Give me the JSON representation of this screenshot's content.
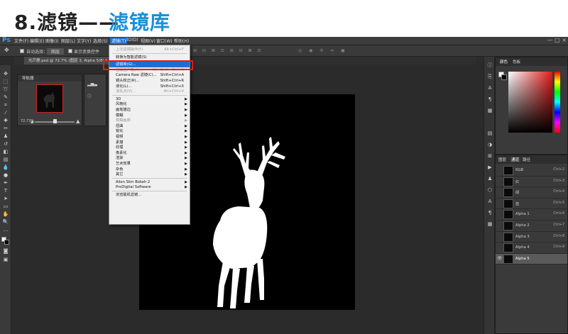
{
  "heading": {
    "prefix": "8.滤镜——",
    "highlight": "滤镜库",
    "accent_color": "#1a8fd6"
  },
  "app": {
    "logo": "Ps",
    "menu": [
      "文件(F)",
      "编辑(E)",
      "图像(I)",
      "图层(L)",
      "文字(Y)",
      "选择(S)",
      "滤镜(T)",
      "3D(D)",
      "视图(V)",
      "窗口(W)",
      "帮助(H)"
    ],
    "active_menu": "滤镜(T)",
    "window_controls": "— □ ×"
  },
  "options_bar": {
    "auto_select": "自动选择：",
    "layer_dropdown": "图层",
    "show_transform": "显示变换控件"
  },
  "document_tab": {
    "label": "光芒鹿.psd @ 72.7% (图层 3, Alpha 5/8) *",
    "close": "×"
  },
  "navigator": {
    "title": "导航器",
    "zoom": "72.73%"
  },
  "filter_menu": {
    "items": [
      {
        "label": "上次滤镜操作(F)",
        "shortcut": "Alt+Ctrl+F",
        "disabled": true
      },
      {
        "sep": true
      },
      {
        "label": "转换为智能滤镜(S)"
      },
      {
        "sep": true
      },
      {
        "label": "滤镜库(G)...",
        "highlighted": true
      },
      {
        "label": "自适应广角(A)...",
        "shortcut": "Alt+Shift+Ctrl+A",
        "disabled": true
      },
      {
        "label": "Camera Raw 滤镜(C)...",
        "shortcut": "Shift+Ctrl+A"
      },
      {
        "label": "镜头校正(R)...",
        "shortcut": "Shift+Ctrl+R"
      },
      {
        "label": "液化(L)...",
        "shortcut": "Shift+Ctrl+X"
      },
      {
        "label": "消失点(V)...",
        "shortcut": "Alt+Ctrl+V",
        "disabled": true
      },
      {
        "sep": true
      },
      {
        "label": "3D",
        "submenu": true
      },
      {
        "label": "风格化",
        "submenu": true
      },
      {
        "label": "画笔描边",
        "submenu": true
      },
      {
        "label": "模糊",
        "submenu": true
      },
      {
        "label": "模糊画廊",
        "submenu": true,
        "disabled": true
      },
      {
        "label": "扭曲",
        "submenu": true
      },
      {
        "label": "锐化",
        "submenu": true
      },
      {
        "label": "视频",
        "submenu": true
      },
      {
        "label": "素描",
        "submenu": true
      },
      {
        "label": "纹理",
        "submenu": true
      },
      {
        "label": "像素化",
        "submenu": true
      },
      {
        "label": "渲染",
        "submenu": true
      },
      {
        "label": "艺术效果",
        "submenu": true
      },
      {
        "label": "杂色",
        "submenu": true
      },
      {
        "label": "其它",
        "submenu": true
      },
      {
        "sep": true
      },
      {
        "label": "Alien Skin Bokeh 2",
        "submenu": true
      },
      {
        "label": "ProDigital Software",
        "submenu": true
      },
      {
        "sep": true
      },
      {
        "label": "浏览联机滤镜..."
      }
    ]
  },
  "color_panel": {
    "tabs": [
      "颜色",
      "色板"
    ]
  },
  "channels_panel": {
    "tabs": [
      "图层",
      "通道",
      "路径"
    ],
    "active_tab": "通道",
    "rows": [
      {
        "name": "RGB",
        "shortcut": "Ctrl+2"
      },
      {
        "name": "红",
        "shortcut": "Ctrl+3"
      },
      {
        "name": "绿",
        "shortcut": "Ctrl+4"
      },
      {
        "name": "蓝",
        "shortcut": "Ctrl+5"
      },
      {
        "name": "Alpha 1",
        "shortcut": "Ctrl+6"
      },
      {
        "name": "Alpha 2",
        "shortcut": "Ctrl+7"
      },
      {
        "name": "Alpha 3",
        "shortcut": "Ctrl+8"
      },
      {
        "name": "Alpha 4",
        "shortcut": "Ctrl+9"
      },
      {
        "name": "Alpha 5",
        "shortcut": "",
        "selected": true
      }
    ]
  },
  "colors": {
    "highlight": "#1c6fd1",
    "annotation_box": "#e21b1b"
  }
}
